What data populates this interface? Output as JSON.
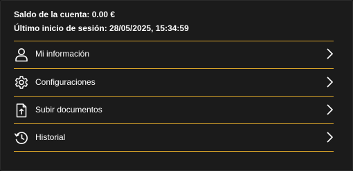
{
  "account": {
    "balance_text": "Saldo de la cuenta: 0.00 €",
    "last_login_text": "Último inicio de sesión: 28/05/2025, 15:34:59"
  },
  "menu": {
    "items": [
      {
        "label": "Mi información",
        "icon": "user-icon"
      },
      {
        "label": "Configuraciones",
        "icon": "gear-icon"
      },
      {
        "label": "Subir documentos",
        "icon": "upload-document-icon"
      },
      {
        "label": "Historial",
        "icon": "history-icon"
      }
    ]
  },
  "colors": {
    "background": "#1b1b1b",
    "divider": "#e0a92a",
    "text": "#ffffff"
  }
}
